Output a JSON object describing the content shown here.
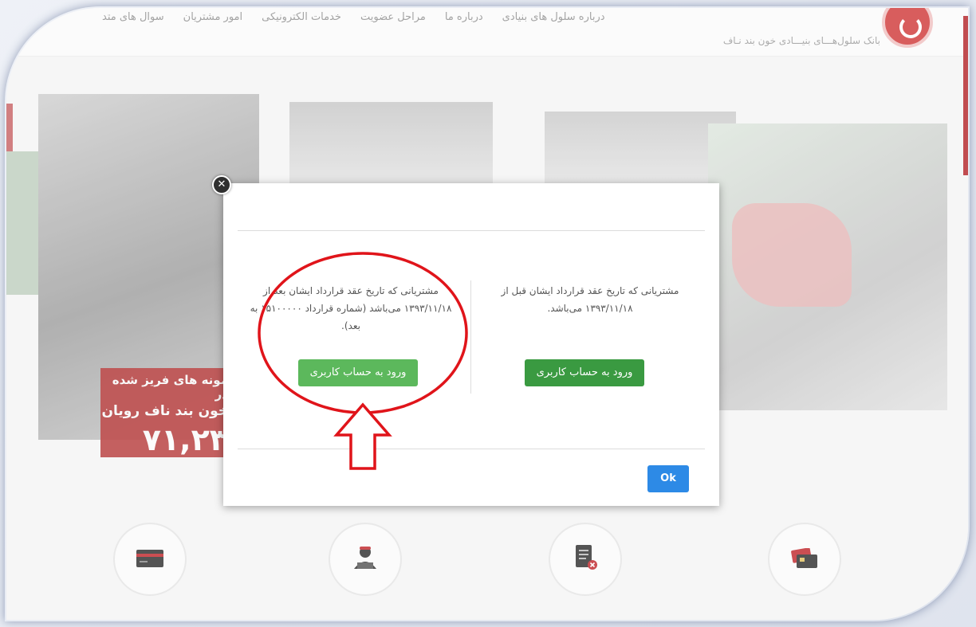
{
  "header": {
    "nav_items": [
      "درباره سلول های بنیادی",
      "درباره ما",
      "مراحل عضویت",
      "خدمات الکترونیکی",
      "امور مشتریان",
      "سوال های متد"
    ],
    "brand_text": "بانک سلول‌هـــای بنیـــادی خون بند نـاف"
  },
  "promo": {
    "line1": "مونه های فریز شده در",
    "line2": "خون بند ناف رویان",
    "number": "۷۱,۲۳"
  },
  "modal": {
    "close_symbol": "✕",
    "right_text": "مشتریانی که تاریخ عقد قرارداد ایشان قبل از ۱۳۹۳/۱۱/۱۸ می‌باشد.",
    "right_button": "ورود به حساب کاربری",
    "left_text": "مشتریانی که تاریخ عقد قرارداد ایشان بعد از ۱۳۹۳/۱۱/۱۸ می‌باشد (شماره قرارداد ۱۵۱۰۰۰۰۰ به بعد).",
    "left_button": "ورود به حساب کاربری",
    "ok_button": "Ok"
  },
  "icons": [
    "credit-card-icon",
    "support-agent-icon",
    "cancel-document-icon",
    "cards-icon"
  ],
  "colors": {
    "brand_red": "#b4252a",
    "button_green": "#3a9a41",
    "button_green_light": "#5cb85c",
    "ok_blue": "#2d8ae6",
    "annotation_red": "#e0141a"
  }
}
